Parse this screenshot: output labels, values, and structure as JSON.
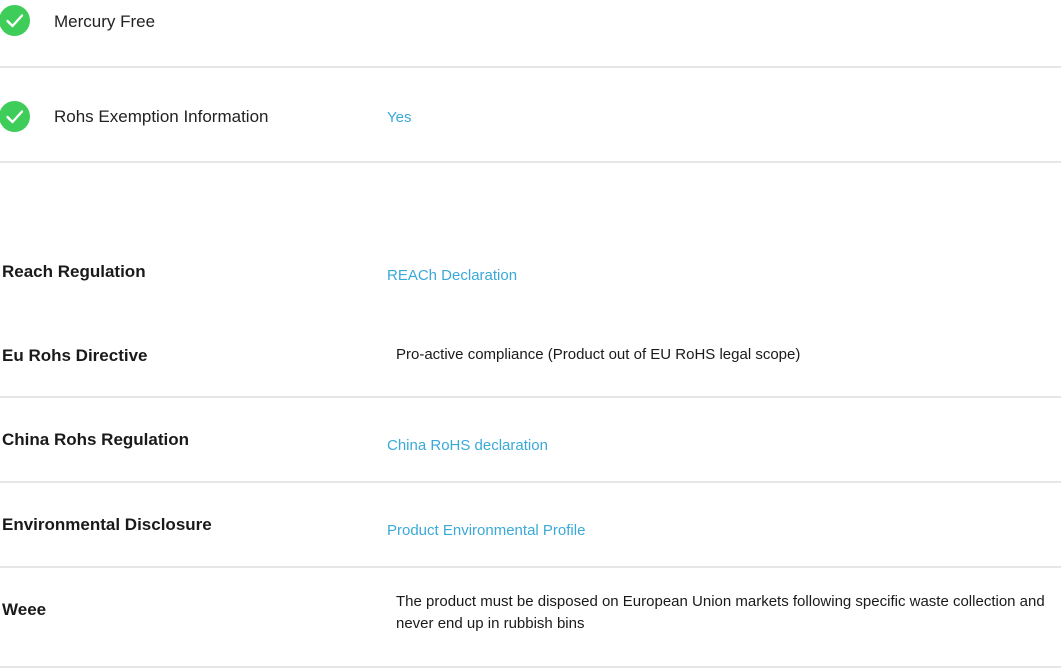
{
  "colors": {
    "accent": "#3aa9d8",
    "check": "#3dcd58"
  },
  "eco_flags": [
    {
      "label": "Mercury Free",
      "icon": "check-circle-icon"
    },
    {
      "label": "Rohs Exemption Information",
      "icon": "check-circle-icon",
      "value": "Yes"
    }
  ],
  "regulations": [
    {
      "heading": "Reach Regulation",
      "value": "REACh Declaration",
      "is_link": true
    },
    {
      "heading": "Eu Rohs Directive",
      "value": "Pro-active compliance (Product out of EU RoHS legal scope)",
      "is_link": false
    },
    {
      "heading": "China Rohs Regulation",
      "value": "China RoHS declaration",
      "is_link": true
    },
    {
      "heading": "Environmental Disclosure",
      "value": "Product Environmental Profile",
      "is_link": true
    },
    {
      "heading": "Weee",
      "value": "The product must be disposed on European Union markets following specific waste collection and never end up in rubbish bins",
      "is_link": false
    }
  ]
}
